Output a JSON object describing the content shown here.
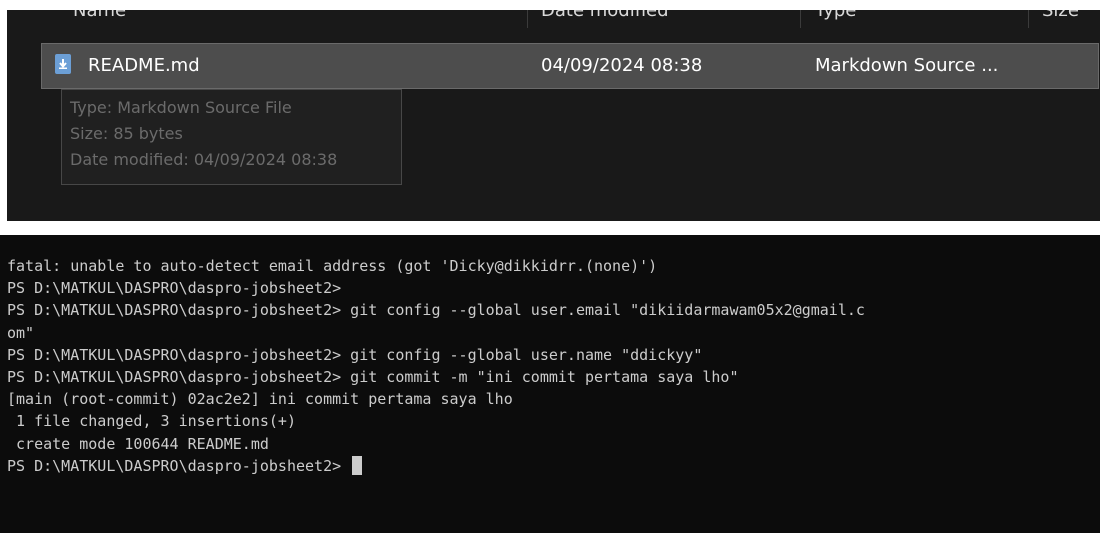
{
  "explorer": {
    "columns": [
      "Name",
      "Date modified",
      "Type",
      "Size"
    ],
    "file": {
      "name": "README.md",
      "date_modified": "04/09/2024 08:38",
      "type": "Markdown Source ...",
      "icon": "markdown-file-icon"
    },
    "tooltip": {
      "type_line": "Type: Markdown Source File",
      "size_line": "Size: 85 bytes",
      "date_line": "Date modified: 04/09/2024 08:38"
    }
  },
  "terminal": {
    "lines": [
      "fatal: unable to auto-detect email address (got 'Dicky@dikkidrr.(none)')",
      "PS D:\\MATKUL\\DASPRO\\daspro-jobsheet2>",
      "PS D:\\MATKUL\\DASPRO\\daspro-jobsheet2> git config --global user.email \"dikiidarmawam05x2@gmail.c",
      "om\"",
      "PS D:\\MATKUL\\DASPRO\\daspro-jobsheet2> git config --global user.name \"ddickyy\"",
      "PS D:\\MATKUL\\DASPRO\\daspro-jobsheet2> git commit -m \"ini commit pertama saya lho\"",
      "[main (root-commit) 02ac2e2] ini commit pertama saya lho",
      " 1 file changed, 3 insertions(+)",
      " create mode 100644 README.md"
    ],
    "prompt": "PS D:\\MATKUL\\DASPRO\\daspro-jobsheet2> "
  },
  "colors": {
    "explorer_bg": "#191919",
    "selected_row": "#4d4d4d",
    "terminal_bg": "#0c0c0c",
    "terminal_text": "#cccccc"
  }
}
